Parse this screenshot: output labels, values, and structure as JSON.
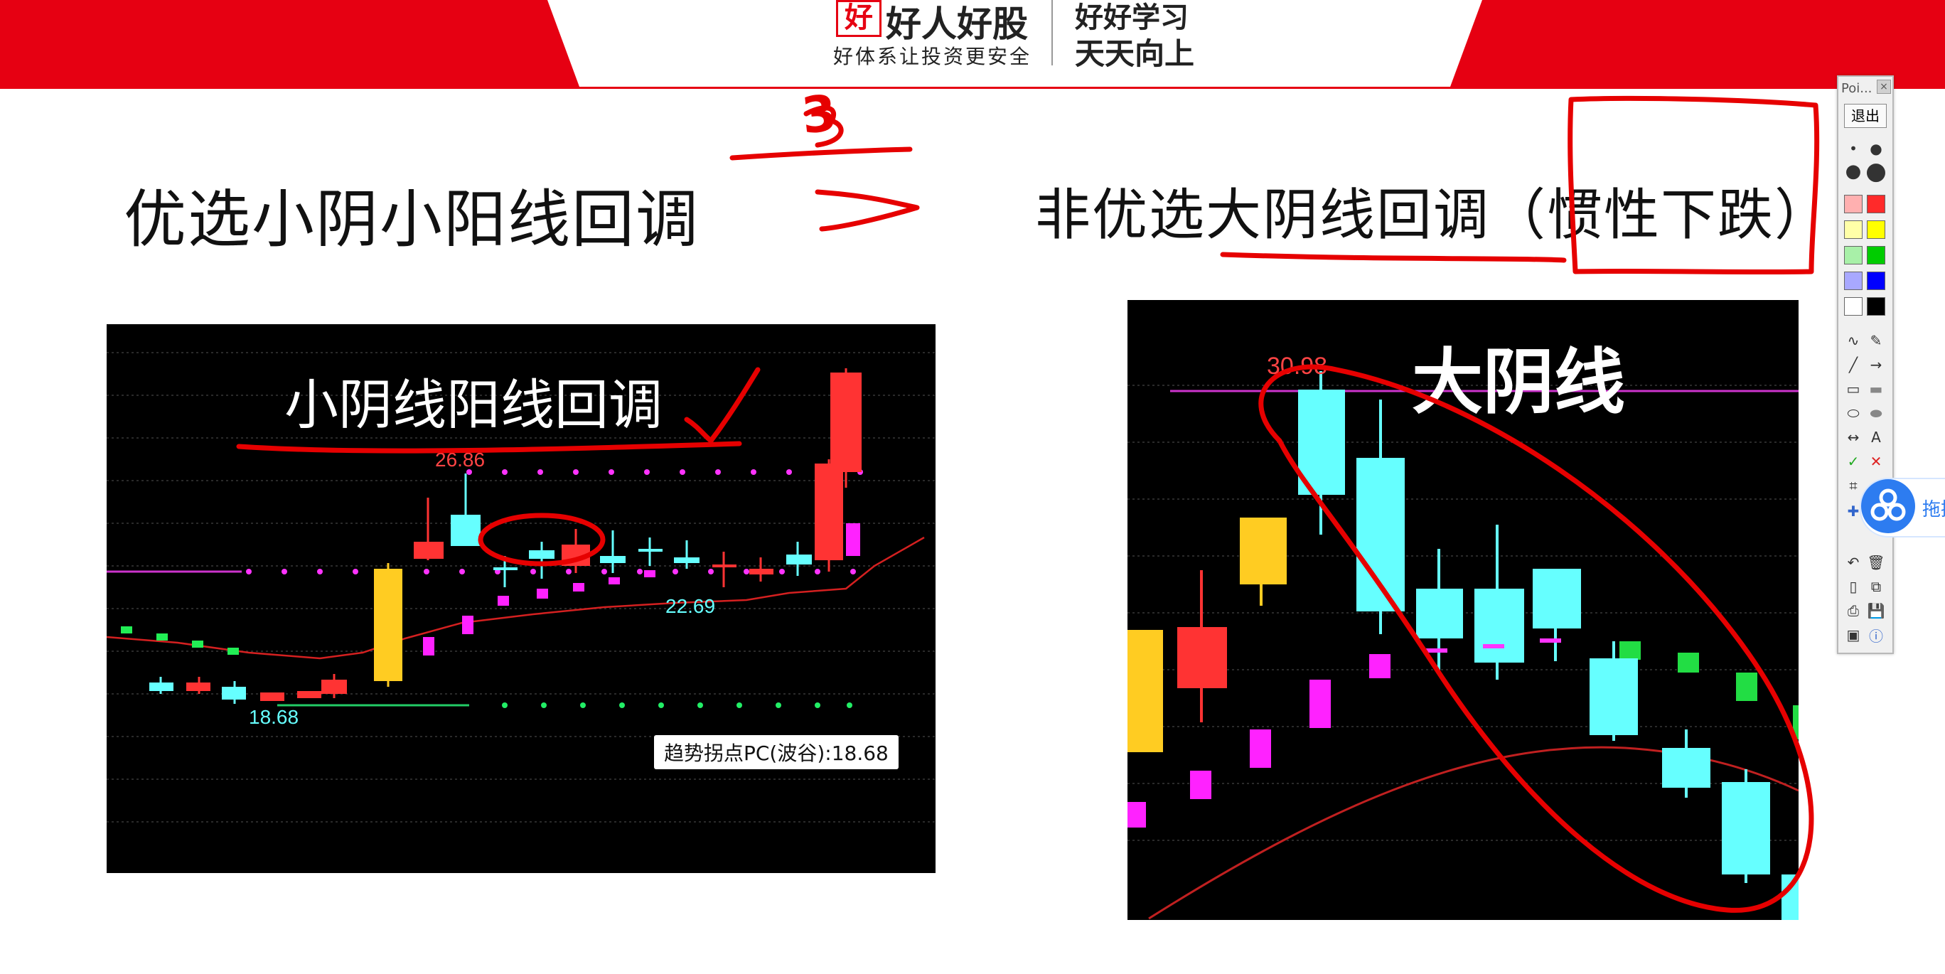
{
  "banner": {
    "logo_mark": "好",
    "brand_name": "好人好股",
    "brand_slogan": "好体系让投资更安全",
    "motto_line1": "好好学习",
    "motto_line2": "天天向上",
    "colors": {
      "band": "#e60012",
      "panel": "#ffffff"
    }
  },
  "left": {
    "heading": "优选小阴小阳线回调",
    "chart": {
      "caption": "小阴线阳线回调",
      "price_high": "26.86",
      "price_mid": "22.69",
      "price_low": "18.68",
      "tooltip": "趋势拐点PC(波谷):18.68"
    }
  },
  "right": {
    "heading": "非优选大阴线回调（惯性下跌）",
    "chart": {
      "caption": "大阴线",
      "price_high": "30.98"
    }
  },
  "annotation": {
    "number_mark": "3",
    "color": "#e60000"
  },
  "toolbar": {
    "title": "Poi...",
    "close": "×",
    "exit_label": "退出",
    "text_tool": "A",
    "swatches": [
      "#ff2a2a",
      "#ffff00",
      "#00cc00",
      "#0000ff",
      "#000000"
    ],
    "icons": [
      "dot-small-icon",
      "dot-large-icon",
      "swatch-red-icon",
      "swatch-yellow-icon",
      "swatch-green-icon",
      "swatch-blue-icon",
      "swatch-black-icon",
      "freehand-icon",
      "eraser-icon",
      "line-icon",
      "arrow-icon",
      "rectangle-icon",
      "filled-rectangle-icon",
      "ellipse-icon",
      "filled-ellipse-icon",
      "double-arrow-icon",
      "text-icon",
      "check-icon",
      "cross-icon",
      "crop-icon",
      "zoom-icon",
      "undo-icon",
      "trash-icon",
      "new-page-icon",
      "copy-icon",
      "print-icon",
      "save-icon",
      "screenshot-icon",
      "info-icon"
    ]
  },
  "side_widget": {
    "label": "拖拽"
  }
}
